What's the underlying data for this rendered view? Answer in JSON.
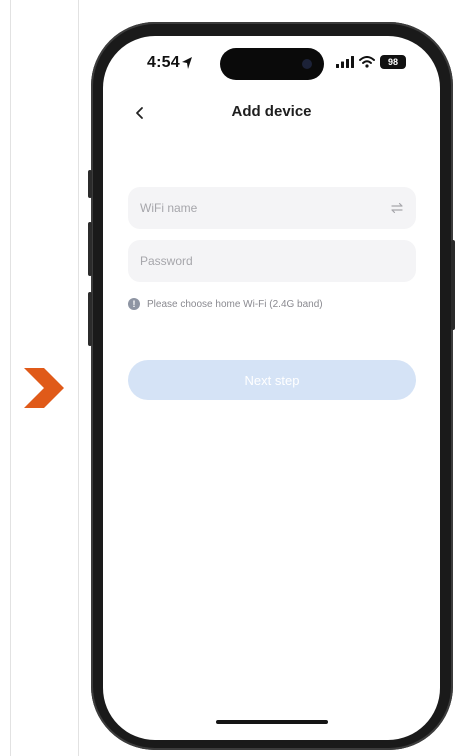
{
  "status_bar": {
    "time": "4:54",
    "battery": "98"
  },
  "header": {
    "title": "Add device",
    "back_icon": "chevron-left-icon"
  },
  "form": {
    "wifi_name": {
      "placeholder": "WiFi name",
      "value": "",
      "icon": "switch-arrows-icon"
    },
    "password": {
      "placeholder": "Password",
      "value": ""
    },
    "hint": "Please choose home Wi-Fi (2.4G band)",
    "hint_icon": "info-icon"
  },
  "actions": {
    "next_label": "Next step",
    "next_enabled": false
  },
  "colors": {
    "accent_arrow": "#e05a19",
    "button_disabled": "#d5e3f6",
    "field_bg": "#f4f4f6"
  }
}
